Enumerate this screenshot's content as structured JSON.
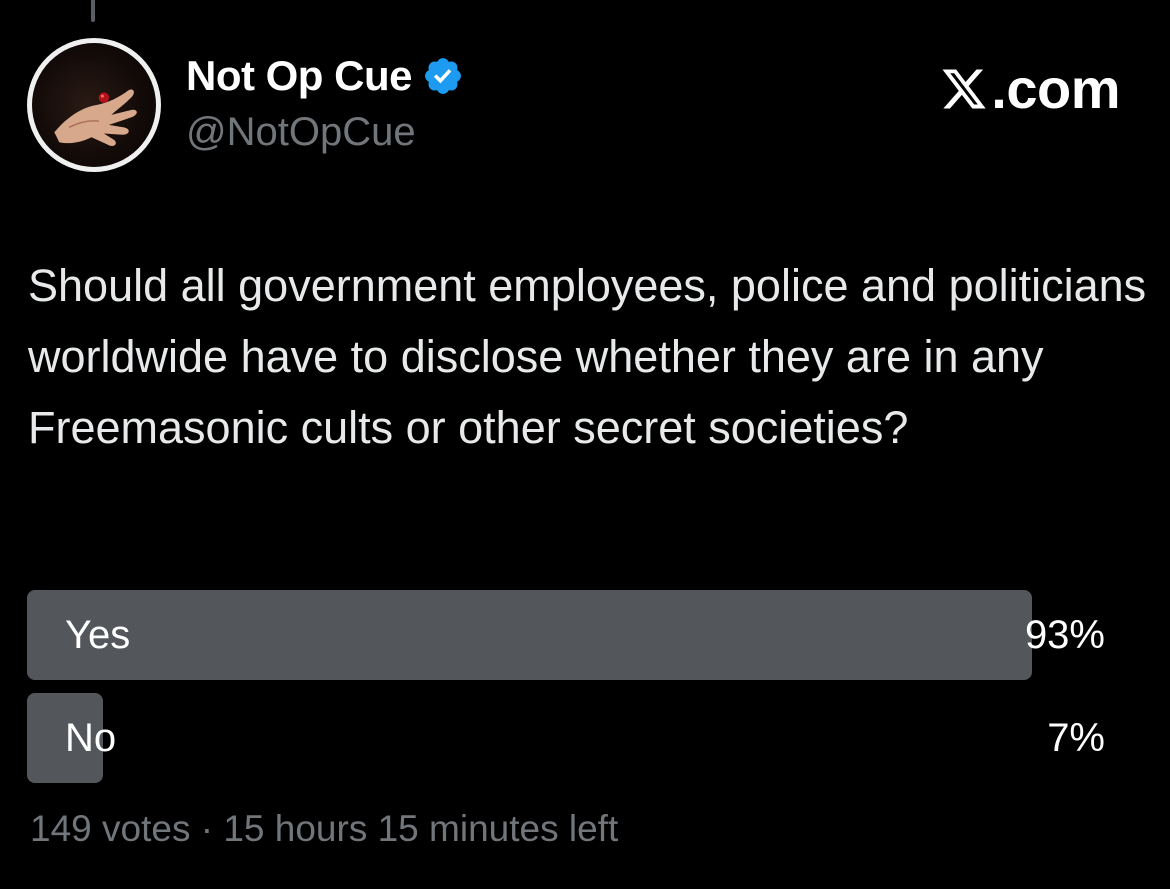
{
  "author": {
    "display_name": "Not Op Cue",
    "handle": "@NotOpCue",
    "verified": true,
    "avatar": "hand-avatar",
    "verified_icon": "verified-badge-icon"
  },
  "watermark": {
    "text": ".com",
    "logo": "x-logo-icon"
  },
  "post": {
    "text": "Should all government employees, police and politicians worldwide have to disclose whether they are in any Freemasonic cults or other secret societies?"
  },
  "poll": {
    "options": [
      {
        "label": "Yes",
        "percent_text": "93%",
        "percent": 93
      },
      {
        "label": "No",
        "percent_text": "7%",
        "percent": 7
      }
    ],
    "meta": "149 votes · 15 hours 15 minutes left"
  },
  "colors": {
    "background": "#000000",
    "bar_fill": "#53575b",
    "secondary_text": "#71767b",
    "verified_blue": "#1d9bf0"
  }
}
